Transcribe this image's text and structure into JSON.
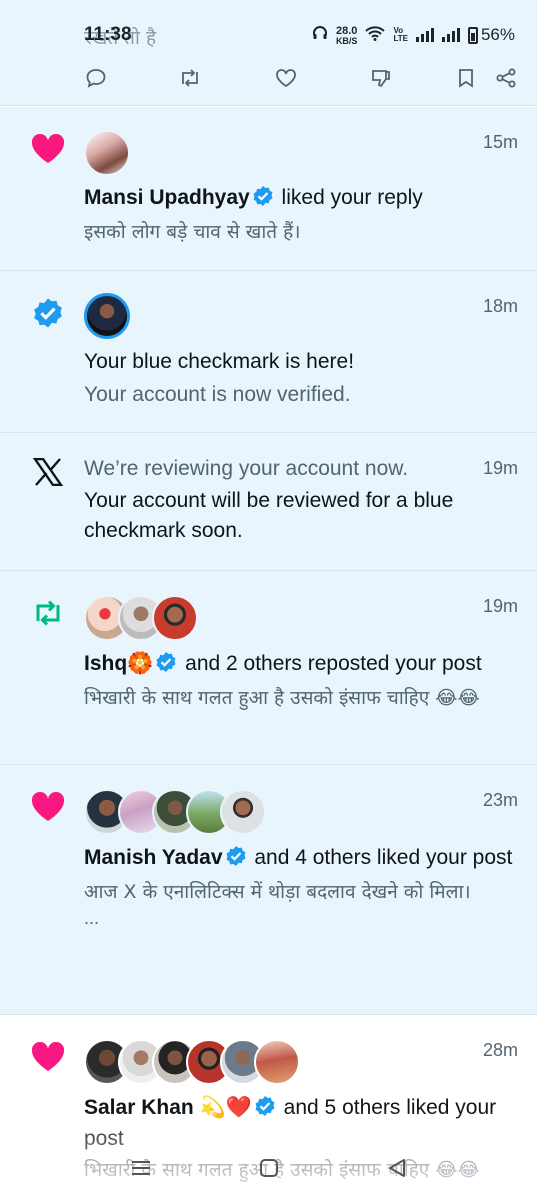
{
  "status_bar": {
    "ghost_text": "रखते तो है",
    "time": "11:38",
    "net_speed_value": "28.0",
    "net_speed_unit": "KB/S",
    "volte_top": "Vo",
    "volte_bottom": "LTE",
    "battery": "56%"
  },
  "action_bar": {
    "icons": [
      "reply-icon",
      "repost-icon",
      "like-icon",
      "dislike-icon",
      "bookmark-icon",
      "share-icon"
    ]
  },
  "notifications": [
    {
      "type": "like",
      "time": "15m",
      "user": "Mansi Upadhyay",
      "action": " liked your reply",
      "text": "इसको लोग बड़े चाव से खाते हैं।"
    },
    {
      "type": "verified",
      "time": "18m",
      "title": "Your blue checkmark is here!",
      "subtitle": "Your account is now verified."
    },
    {
      "type": "x-review",
      "time": "19m",
      "title": "We’re reviewing your account now.",
      "text": "Your account will be reviewed for a blue checkmark soon."
    },
    {
      "type": "repost",
      "time": "19m",
      "user": "Ishq🏵️",
      "action": " and 2 others reposted your post",
      "text": "भिखारी के साथ गलत हुआ है उसको इंसाफ चाहिए 😂😂"
    },
    {
      "type": "like",
      "time": "23m",
      "user": "Manish Yadav",
      "action": " and 4 others liked your post",
      "text": "आज X के एनालिटिक्स में थोड़ा बदलाव देखने को मिला।",
      "ellipsis": "..."
    },
    {
      "type": "like",
      "time": "28m",
      "user": "Salar Khan 💫❤️",
      "action": " and 5 others liked your post",
      "text": "भिखारी के साथ गलत हुआ है उसको इंसाफ चाहिए 😂😂"
    }
  ],
  "nav_bar": {
    "icons": [
      "recents-icon",
      "home-icon",
      "back-icon"
    ]
  },
  "colors": {
    "unread_bg": "#e8f5fd",
    "like": "#f91880",
    "repost": "#00ba7c",
    "verified": "#1d9bf0",
    "muted": "#536471"
  }
}
